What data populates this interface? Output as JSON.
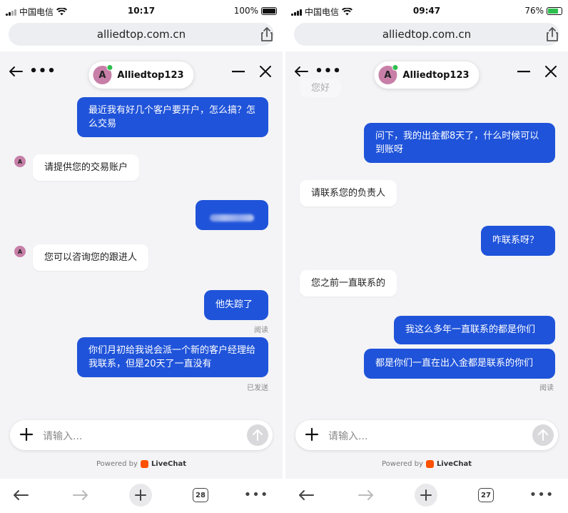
{
  "left": {
    "status": {
      "carrier": "中国电信",
      "time": "10:17",
      "battery": "100%",
      "battery_level": 1.0
    },
    "url": "alliedtop.com.cn",
    "agent": {
      "initial": "A",
      "name": "Alliedtop123"
    },
    "messages": [
      {
        "text": "最近我有好几个客户要开户，怎么搞？怎么交易"
      },
      {
        "text": "请提供您的交易账户"
      },
      {
        "text": ""
      },
      {
        "text": "您可以咨询您的跟进人"
      },
      {
        "text": "他失踪了"
      },
      {
        "text": "你们月初给我说会派一个新的客户经理给我联系，但是20天了一直没有"
      }
    ],
    "status_labels": {
      "read": "阅读",
      "sent": "已发送"
    },
    "input_placeholder": "请输入...",
    "powered_by": "Powered by",
    "livechat": "LiveChat",
    "tab_count": "28"
  },
  "right": {
    "status": {
      "carrier": "中国电信",
      "time": "09:47",
      "battery": "76%",
      "battery_level": 0.76
    },
    "url": "alliedtop.com.cn",
    "agent": {
      "initial": "A",
      "name": "Alliedtop123"
    },
    "messages": [
      {
        "text": "您好"
      },
      {
        "text": "问下，我的出金都8天了，什么时候可以到账呀"
      },
      {
        "text": "请联系您的负责人"
      },
      {
        "text": "咋联系呀？"
      },
      {
        "text": "您之前一直联系的"
      },
      {
        "text": "我这么多年一直联系的都是你们"
      },
      {
        "text": "都是你们一直在出入金都是联系的你们"
      }
    ],
    "status_labels": {
      "read": "阅读"
    },
    "input_placeholder": "请输入...",
    "powered_by": "Powered by",
    "livechat": "LiveChat",
    "tab_count": "27"
  },
  "colors": {
    "outgoing": "#1f53d9",
    "incoming": "#ffffff",
    "avatar": "#c77fa8",
    "online": "#2dbf4e",
    "livechat": "#ff5100"
  },
  "icons": [
    "wifi-icon",
    "share-icon",
    "back-arrow-icon",
    "more-icon",
    "minimize-icon",
    "close-icon",
    "plus-icon",
    "send-arrow-icon",
    "forward-arrow-icon",
    "tabs-icon"
  ]
}
